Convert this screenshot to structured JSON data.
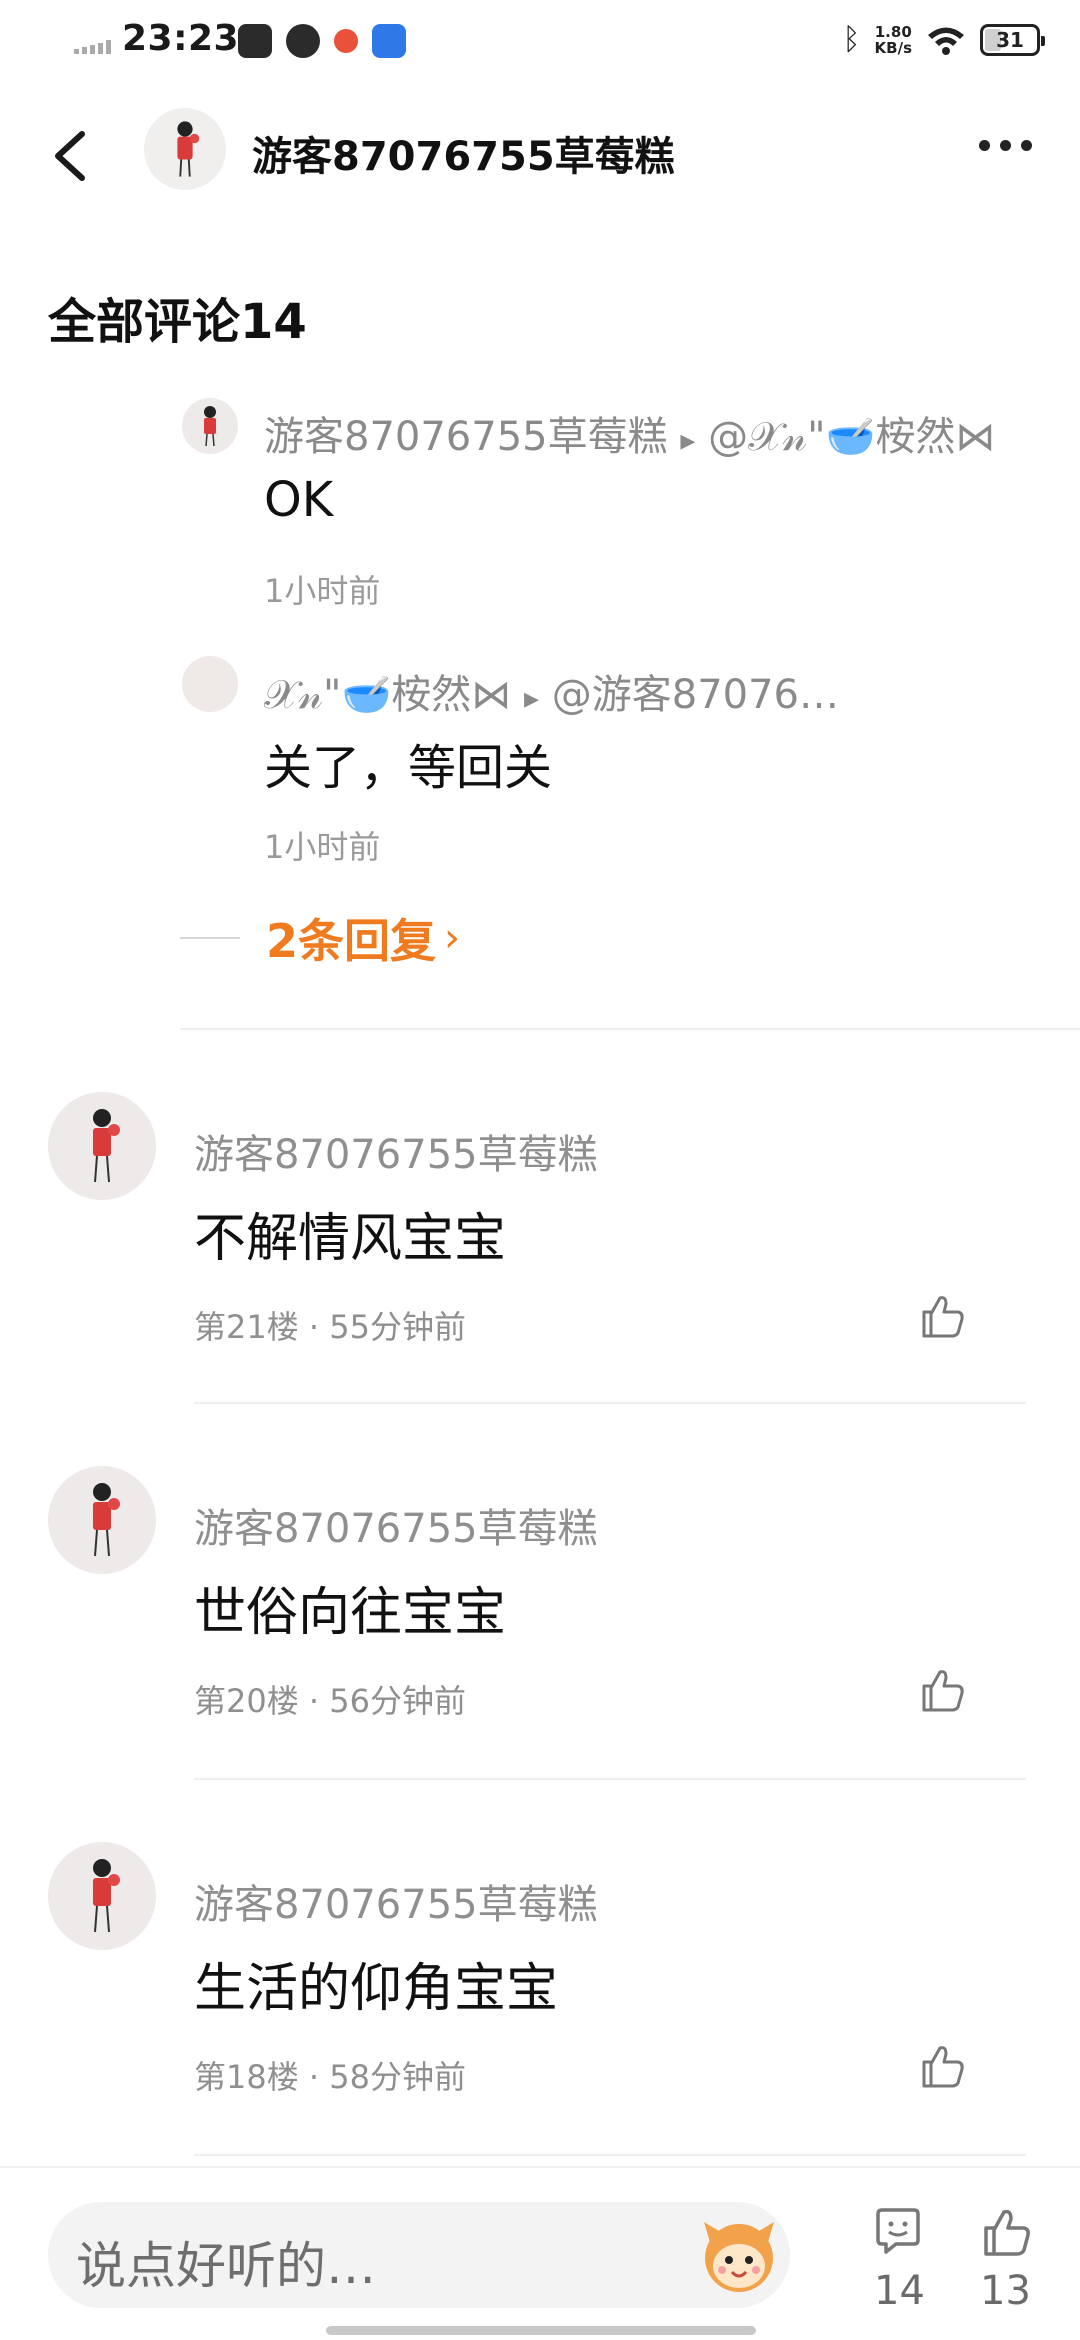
{
  "status_bar": {
    "time": "23:23",
    "network_speed_value": "1.80",
    "network_speed_unit": "KB/s",
    "battery_level": "31"
  },
  "header": {
    "title": "游客87076755草莓糕"
  },
  "section": {
    "title": "全部评论14"
  },
  "replies": [
    {
      "author": "游客87076755草莓糕",
      "arrow": "▸",
      "target": "@𝒳𝓃\"🥣桉然⋈",
      "text": "OK",
      "time": "1小时前"
    },
    {
      "author": "𝒳𝓃\"🥣桉然⋈",
      "arrow": "▸",
      "target": "@游客87076…",
      "text": "关了，等回关",
      "time": "1小时前"
    }
  ],
  "more_replies": {
    "label": "2条回复",
    "chevron": "›"
  },
  "comments": [
    {
      "author": "游客87076755草莓糕",
      "text": "不解情风宝宝",
      "meta": "第21楼 · 55分钟前"
    },
    {
      "author": "游客87076755草莓糕",
      "text": "世俗向往宝宝",
      "meta": "第20楼 · 56分钟前"
    },
    {
      "author": "游客87076755草莓糕",
      "text": "生活的仰角宝宝",
      "meta": "第18楼 · 58分钟前"
    }
  ],
  "bottom_bar": {
    "input_placeholder": "说点好听的…",
    "comment_count": "14",
    "like_count": "13"
  },
  "colors": {
    "accent": "#f07a1e",
    "secondary_text": "#8f8f8f"
  },
  "icons": [
    "back-arrow-icon",
    "more-dots-icon",
    "thumbs-up-icon",
    "comment-bubble-icon",
    "mascot-emoji-icon"
  ]
}
